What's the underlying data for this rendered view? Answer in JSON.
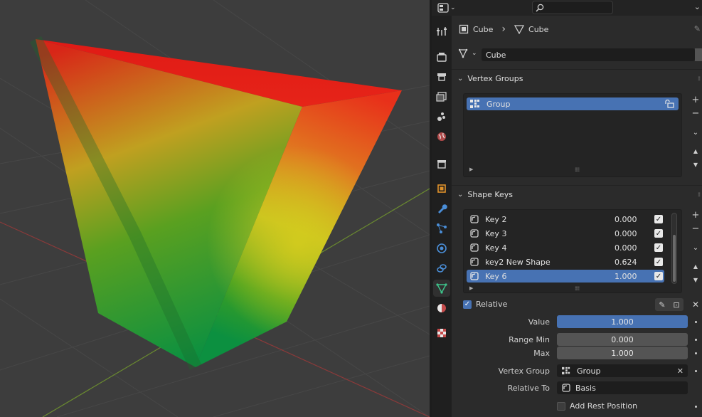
{
  "header": {
    "search_placeholder": ""
  },
  "breadcrumb": {
    "object_name": "Cube",
    "separator": "›",
    "mesh_name": "Cube"
  },
  "datablock": {
    "name": "Cube"
  },
  "vertex_groups": {
    "title": "Vertex Groups",
    "items": [
      {
        "label": "Group",
        "selected": true
      }
    ]
  },
  "shape_keys": {
    "title": "Shape Keys",
    "items": [
      {
        "label": "Key 2",
        "value": "0.000",
        "selected": false
      },
      {
        "label": "Key 3",
        "value": "0.000",
        "selected": false
      },
      {
        "label": "Key 4",
        "value": "0.000",
        "selected": false
      },
      {
        "label": "key2 New Shape",
        "value": "0.624",
        "selected": false
      },
      {
        "label": "Key 6",
        "value": "1.000",
        "selected": true
      }
    ],
    "relative_label": "Relative",
    "value_label": "Value",
    "value": "1.000",
    "range_min_label": "Range Min",
    "range_min": "0.000",
    "max_label": "Max",
    "max": "1.000",
    "vertex_group_label": "Vertex Group",
    "vertex_group": "Group",
    "relative_to_label": "Relative To",
    "relative_to": "Basis",
    "add_rest_label": "Add Rest Position"
  },
  "colors": {
    "accent": "#4772b3",
    "panel": "#2b2b2b",
    "field": "#1d1d1d"
  }
}
